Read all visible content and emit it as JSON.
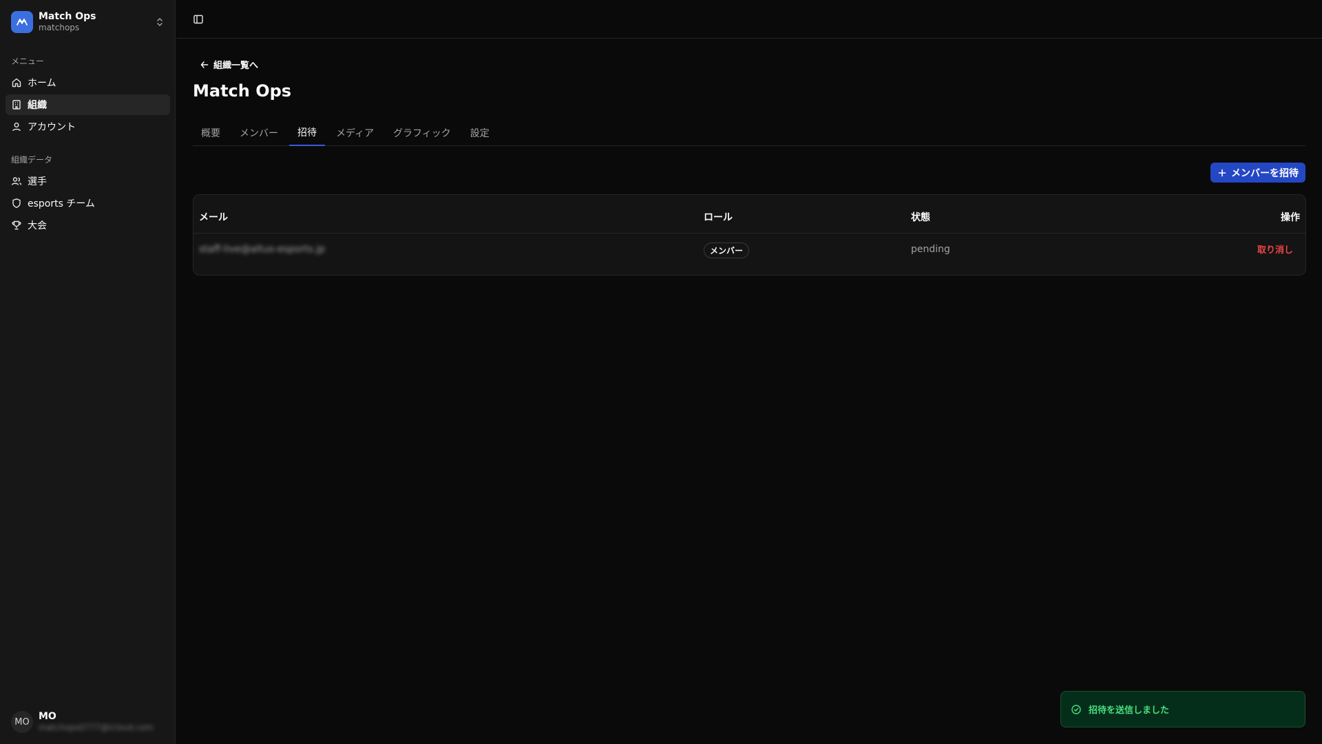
{
  "org": {
    "name": "Match Ops",
    "slug": "matchops"
  },
  "sidebar": {
    "menu_label": "メニュー",
    "menu_items": [
      {
        "label": "ホーム",
        "icon": "home-icon"
      },
      {
        "label": "組織",
        "icon": "building-icon",
        "active": true
      },
      {
        "label": "アカウント",
        "icon": "user-icon"
      }
    ],
    "data_label": "組織データ",
    "data_items": [
      {
        "label": "選手",
        "icon": "users-icon"
      },
      {
        "label": "esports チーム",
        "icon": "shield-icon"
      },
      {
        "label": "大会",
        "icon": "trophy-icon"
      }
    ]
  },
  "user": {
    "initials": "MO",
    "name": "MO",
    "email": "matchops0777@icloud.com"
  },
  "page": {
    "back_label": "組織一覧へ",
    "title": "Match Ops",
    "tabs": [
      {
        "label": "概要"
      },
      {
        "label": "メンバー"
      },
      {
        "label": "招待",
        "active": true
      },
      {
        "label": "メディア"
      },
      {
        "label": "グラフィック"
      },
      {
        "label": "設定"
      }
    ],
    "invite_button": "メンバーを招待"
  },
  "table": {
    "headers": {
      "email": "メール",
      "role": "ロール",
      "status": "状態",
      "actions": "操作"
    },
    "rows": [
      {
        "email": "staff-live@altus-esports.jp",
        "role": "メンバー",
        "status": "pending",
        "action": "取り消し"
      }
    ]
  },
  "toast": {
    "message": "招待を送信しました"
  },
  "colors": {
    "accent": "#2447c4",
    "danger": "#ef4444",
    "success": "#4ade80",
    "logo": "#3b6fe0"
  }
}
